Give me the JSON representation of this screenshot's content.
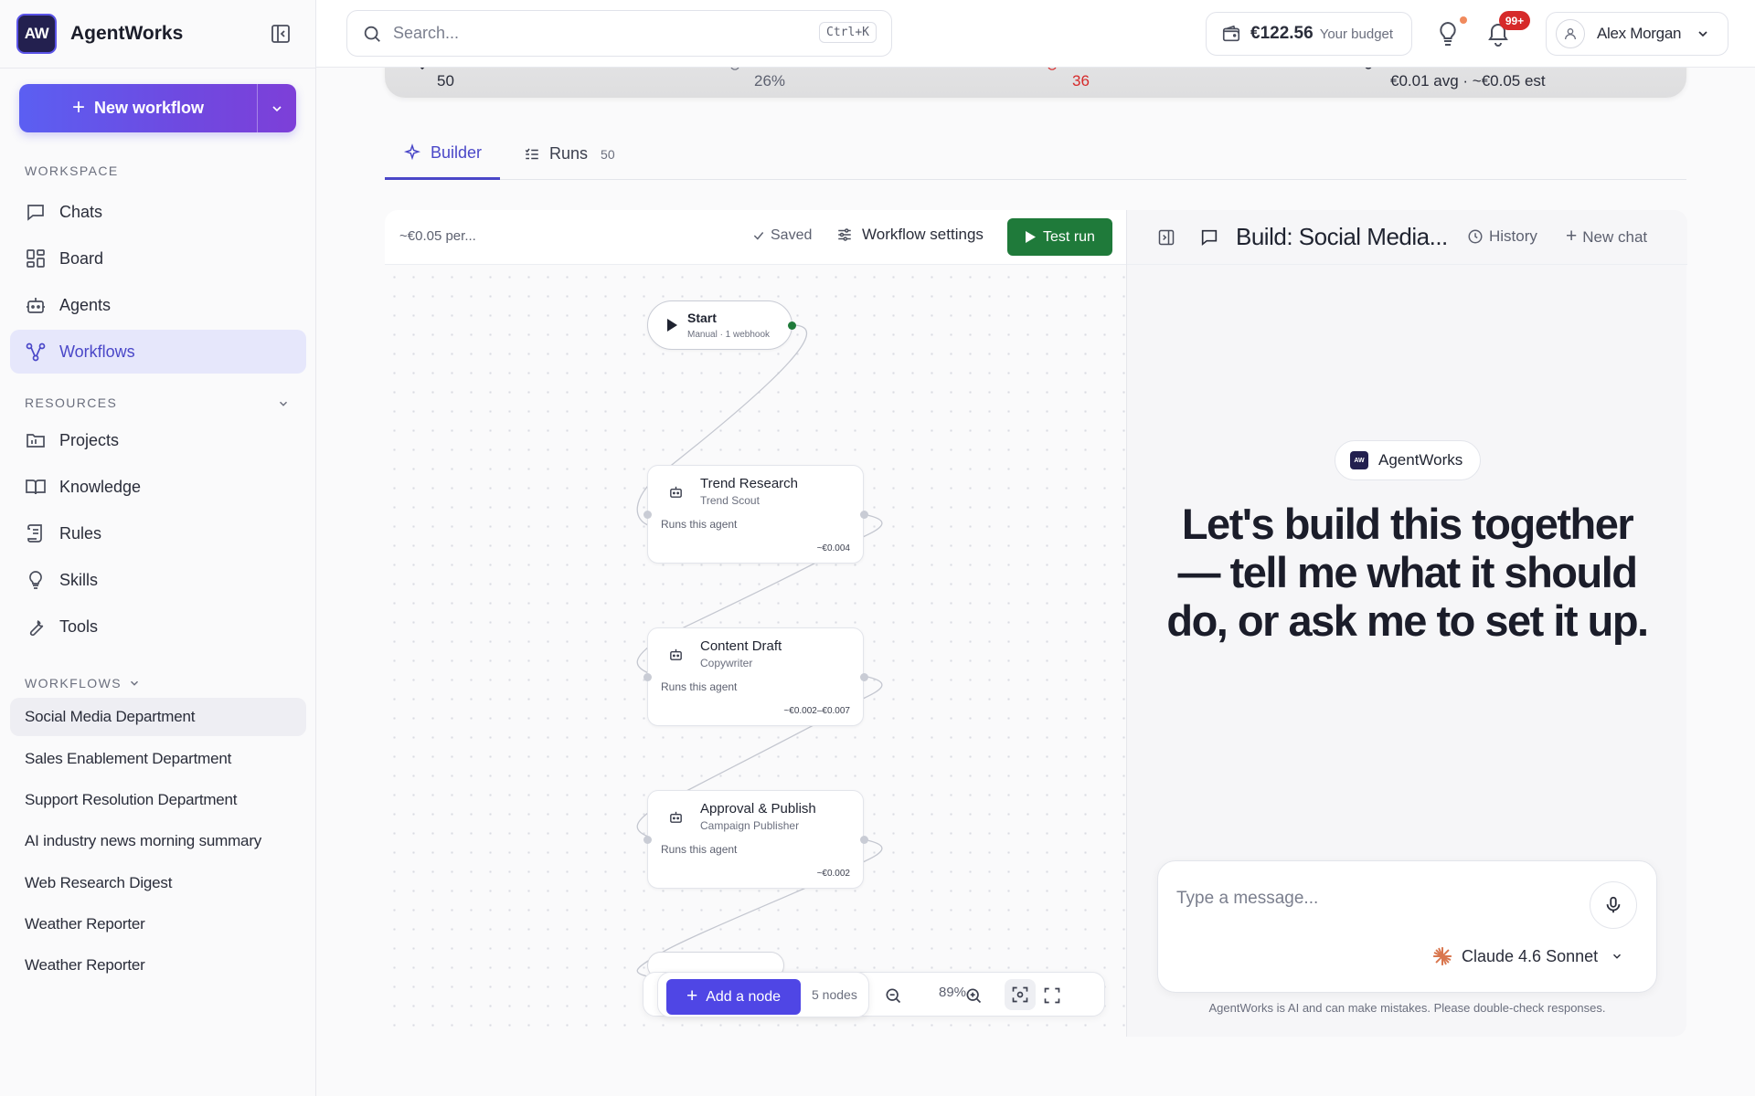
{
  "app": {
    "logo_text": "AW",
    "name": "AgentWorks"
  },
  "sidebar": {
    "new_workflow_label": "New workflow",
    "workspace_label": "WORKSPACE",
    "workspace_items": [
      {
        "label": "Chats",
        "icon": "chat-icon"
      },
      {
        "label": "Board",
        "icon": "board-icon"
      },
      {
        "label": "Agents",
        "icon": "robot-icon"
      },
      {
        "label": "Workflows",
        "icon": "workflow-icon",
        "active": true
      }
    ],
    "resources_label": "RESOURCES",
    "resources_items": [
      {
        "label": "Projects",
        "icon": "folder-icon"
      },
      {
        "label": "Knowledge",
        "icon": "book-icon"
      },
      {
        "label": "Rules",
        "icon": "scroll-icon"
      },
      {
        "label": "Skills",
        "icon": "lightbulb-icon"
      },
      {
        "label": "Tools",
        "icon": "wrench-icon"
      }
    ],
    "workflows_label": "WORKFLOWS",
    "workflows": [
      {
        "label": "Social Media Department",
        "active": true
      },
      {
        "label": "Sales Enablement Department"
      },
      {
        "label": "Support Resolution Department"
      },
      {
        "label": "AI industry news morning summary"
      },
      {
        "label": "Web Research Digest"
      },
      {
        "label": "Weather Reporter"
      },
      {
        "label": "Weather Reporter"
      }
    ]
  },
  "header": {
    "search_placeholder": "Search...",
    "search_shortcut": "Ctrl+K",
    "budget_amount": "€122.56",
    "budget_label": "Your budget",
    "notifications_badge": "99+",
    "user_name": "Alex Morgan"
  },
  "stats": {
    "runs": "50",
    "rate": "26%",
    "failed": "36",
    "cost": "€0.01 avg · ~€0.05 est"
  },
  "tabs": {
    "builder": "Builder",
    "runs": "Runs",
    "runs_count": "50"
  },
  "builder": {
    "cost_per": "~€0.05 per...",
    "saved_label": "Saved",
    "settings_label": "Workflow settings",
    "test_run_label": "Test run",
    "start_node": {
      "title": "Start",
      "subtitle": "Manual · 1 webhook"
    },
    "nodes": [
      {
        "title": "Trend Research",
        "subtitle": "Trend Scout",
        "desc": "Runs this agent",
        "cost": "~€0.004"
      },
      {
        "title": "Content Draft",
        "subtitle": "Copywriter",
        "desc": "Runs this agent",
        "cost": "~€0.002–€0.007"
      },
      {
        "title": "Approval & Publish",
        "subtitle": "Campaign Publisher",
        "desc": "Runs this agent",
        "cost": "~€0.002"
      }
    ],
    "add_node_label": "Add a node",
    "node_count": "5 nodes",
    "zoom": "89%"
  },
  "chat": {
    "title": "Build: Social Media...",
    "history_label": "History",
    "new_chat_label": "New chat",
    "agent_chip_logo": "AW",
    "agent_chip": "AgentWorks",
    "hero": "Let's build this together — tell me what it should do, or ask me to set it up.",
    "input_placeholder": "Type a message...",
    "model": "Claude 4.6 Sonnet",
    "disclaimer": "AgentWorks is AI and can make mistakes. Please double-check responses."
  },
  "colors": {
    "accent": "#4f46e5",
    "success": "#1f7a3a",
    "danger": "#d62a2a"
  }
}
